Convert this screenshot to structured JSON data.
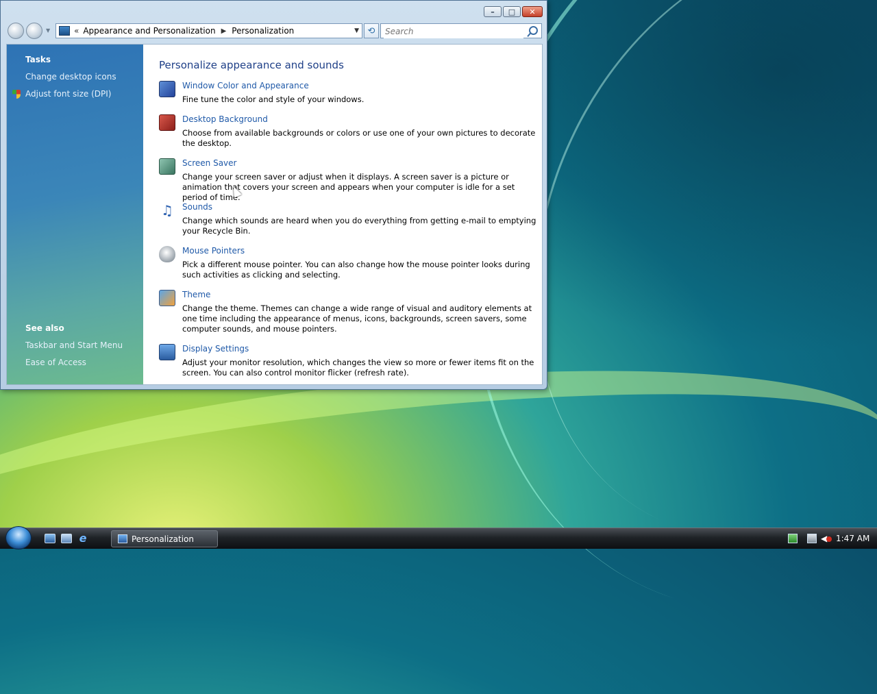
{
  "window": {
    "caption_buttons": {
      "minimize": "–",
      "maximize": "□",
      "close": "✕"
    },
    "address": {
      "chevron": "«",
      "crumbs": [
        "Appearance and Personalization",
        "Personalization"
      ]
    },
    "search": {
      "placeholder": "Search"
    }
  },
  "left_pane": {
    "tasks_heading": "Tasks",
    "tasks": [
      {
        "label": "Change desktop icons"
      },
      {
        "label": "Adjust font size (DPI)",
        "icon": "uac-shield-icon"
      }
    ],
    "see_also_heading": "See also",
    "see_also": [
      {
        "label": "Taskbar and Start Menu"
      },
      {
        "label": "Ease of Access"
      }
    ]
  },
  "main": {
    "title": "Personalize appearance and sounds",
    "items": [
      {
        "icon": "window-color-icon",
        "title": "Window Color and Appearance",
        "desc": "Fine tune the color and style of your windows."
      },
      {
        "icon": "desktop-background-icon",
        "title": "Desktop Background",
        "desc": "Choose from available backgrounds or colors or use one of your own pictures to decorate the desktop."
      },
      {
        "icon": "screen-saver-icon",
        "title": "Screen Saver",
        "desc": "Change your screen saver or adjust when it displays. A screen saver is a picture or animation that covers your screen and appears when your computer is idle for a set period of time."
      },
      {
        "icon": "sounds-icon",
        "title": "Sounds",
        "desc": "Change which sounds are heard when you do everything from getting e-mail to emptying your Recycle Bin."
      },
      {
        "icon": "mouse-pointers-icon",
        "title": "Mouse Pointers",
        "desc": "Pick a different mouse pointer. You can also change how the mouse pointer looks during such activities as clicking and selecting."
      },
      {
        "icon": "theme-icon",
        "title": "Theme",
        "desc": "Change the theme. Themes can change a wide range of visual and auditory elements at one time including the appearance of menus, icons, backgrounds, screen savers, some computer sounds, and mouse pointers."
      },
      {
        "icon": "display-settings-icon",
        "title": "Display Settings",
        "desc": "Adjust your monitor resolution, which changes the view so more or fewer items fit on the screen. You can also control monitor flicker (refresh rate)."
      }
    ]
  },
  "taskbar": {
    "active_task": "Personalization",
    "quick_launch": [
      "show-desktop-icon",
      "switch-windows-icon",
      "internet-explorer-icon"
    ],
    "clock": "1:47 AM"
  }
}
